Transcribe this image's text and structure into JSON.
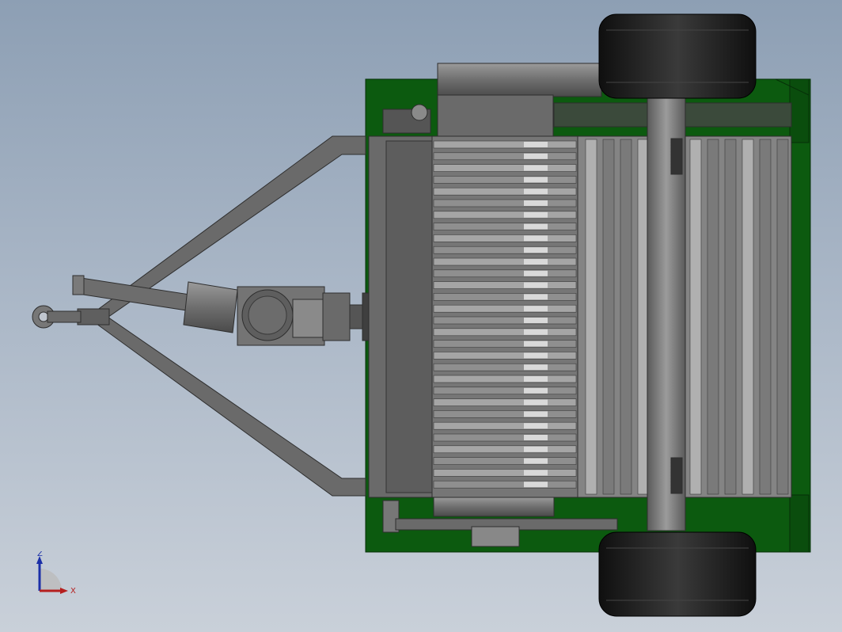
{
  "viewport": {
    "background_top": "#8d9fb4",
    "background_bottom": "#c9d0d9"
  },
  "model": {
    "frame_color": "#0c5a0f",
    "body_color": "#6f6f6f",
    "tire_color": "#1e1e1e"
  },
  "triad": {
    "z_label": "Z",
    "x_label": "X",
    "z_color": "#1b2fa8",
    "x_color": "#b51f1f",
    "y_icon": "y-axis-arrow-icon"
  }
}
